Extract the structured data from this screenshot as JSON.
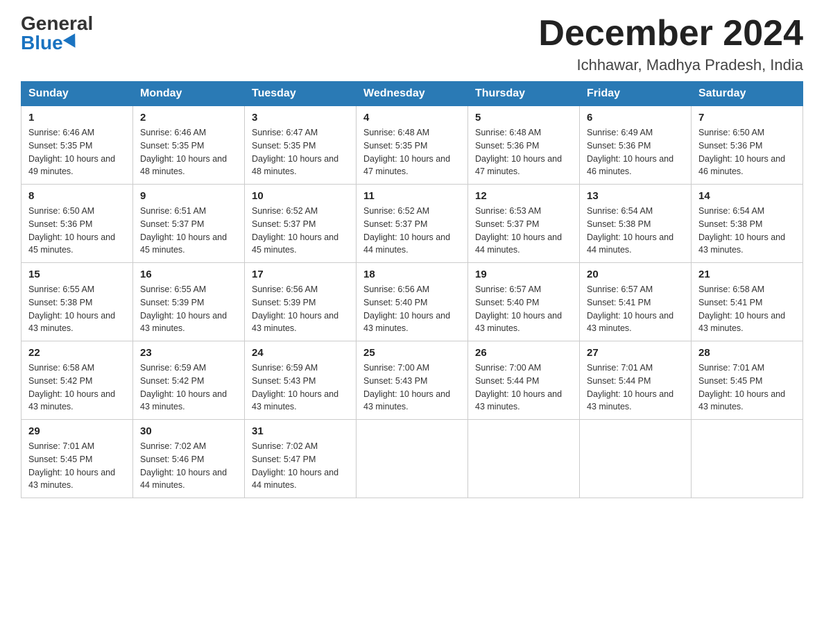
{
  "header": {
    "logo_general": "General",
    "logo_blue": "Blue",
    "month_title": "December 2024",
    "location": "Ichhawar, Madhya Pradesh, India"
  },
  "weekdays": [
    "Sunday",
    "Monday",
    "Tuesday",
    "Wednesday",
    "Thursday",
    "Friday",
    "Saturday"
  ],
  "weeks": [
    [
      {
        "day": "1",
        "sunrise": "6:46 AM",
        "sunset": "5:35 PM",
        "daylight": "10 hours and 49 minutes."
      },
      {
        "day": "2",
        "sunrise": "6:46 AM",
        "sunset": "5:35 PM",
        "daylight": "10 hours and 48 minutes."
      },
      {
        "day": "3",
        "sunrise": "6:47 AM",
        "sunset": "5:35 PM",
        "daylight": "10 hours and 48 minutes."
      },
      {
        "day": "4",
        "sunrise": "6:48 AM",
        "sunset": "5:35 PM",
        "daylight": "10 hours and 47 minutes."
      },
      {
        "day": "5",
        "sunrise": "6:48 AM",
        "sunset": "5:36 PM",
        "daylight": "10 hours and 47 minutes."
      },
      {
        "day": "6",
        "sunrise": "6:49 AM",
        "sunset": "5:36 PM",
        "daylight": "10 hours and 46 minutes."
      },
      {
        "day": "7",
        "sunrise": "6:50 AM",
        "sunset": "5:36 PM",
        "daylight": "10 hours and 46 minutes."
      }
    ],
    [
      {
        "day": "8",
        "sunrise": "6:50 AM",
        "sunset": "5:36 PM",
        "daylight": "10 hours and 45 minutes."
      },
      {
        "day": "9",
        "sunrise": "6:51 AM",
        "sunset": "5:37 PM",
        "daylight": "10 hours and 45 minutes."
      },
      {
        "day": "10",
        "sunrise": "6:52 AM",
        "sunset": "5:37 PM",
        "daylight": "10 hours and 45 minutes."
      },
      {
        "day": "11",
        "sunrise": "6:52 AM",
        "sunset": "5:37 PM",
        "daylight": "10 hours and 44 minutes."
      },
      {
        "day": "12",
        "sunrise": "6:53 AM",
        "sunset": "5:37 PM",
        "daylight": "10 hours and 44 minutes."
      },
      {
        "day": "13",
        "sunrise": "6:54 AM",
        "sunset": "5:38 PM",
        "daylight": "10 hours and 44 minutes."
      },
      {
        "day": "14",
        "sunrise": "6:54 AM",
        "sunset": "5:38 PM",
        "daylight": "10 hours and 43 minutes."
      }
    ],
    [
      {
        "day": "15",
        "sunrise": "6:55 AM",
        "sunset": "5:38 PM",
        "daylight": "10 hours and 43 minutes."
      },
      {
        "day": "16",
        "sunrise": "6:55 AM",
        "sunset": "5:39 PM",
        "daylight": "10 hours and 43 minutes."
      },
      {
        "day": "17",
        "sunrise": "6:56 AM",
        "sunset": "5:39 PM",
        "daylight": "10 hours and 43 minutes."
      },
      {
        "day": "18",
        "sunrise": "6:56 AM",
        "sunset": "5:40 PM",
        "daylight": "10 hours and 43 minutes."
      },
      {
        "day": "19",
        "sunrise": "6:57 AM",
        "sunset": "5:40 PM",
        "daylight": "10 hours and 43 minutes."
      },
      {
        "day": "20",
        "sunrise": "6:57 AM",
        "sunset": "5:41 PM",
        "daylight": "10 hours and 43 minutes."
      },
      {
        "day": "21",
        "sunrise": "6:58 AM",
        "sunset": "5:41 PM",
        "daylight": "10 hours and 43 minutes."
      }
    ],
    [
      {
        "day": "22",
        "sunrise": "6:58 AM",
        "sunset": "5:42 PM",
        "daylight": "10 hours and 43 minutes."
      },
      {
        "day": "23",
        "sunrise": "6:59 AM",
        "sunset": "5:42 PM",
        "daylight": "10 hours and 43 minutes."
      },
      {
        "day": "24",
        "sunrise": "6:59 AM",
        "sunset": "5:43 PM",
        "daylight": "10 hours and 43 minutes."
      },
      {
        "day": "25",
        "sunrise": "7:00 AM",
        "sunset": "5:43 PM",
        "daylight": "10 hours and 43 minutes."
      },
      {
        "day": "26",
        "sunrise": "7:00 AM",
        "sunset": "5:44 PM",
        "daylight": "10 hours and 43 minutes."
      },
      {
        "day": "27",
        "sunrise": "7:01 AM",
        "sunset": "5:44 PM",
        "daylight": "10 hours and 43 minutes."
      },
      {
        "day": "28",
        "sunrise": "7:01 AM",
        "sunset": "5:45 PM",
        "daylight": "10 hours and 43 minutes."
      }
    ],
    [
      {
        "day": "29",
        "sunrise": "7:01 AM",
        "sunset": "5:45 PM",
        "daylight": "10 hours and 43 minutes."
      },
      {
        "day": "30",
        "sunrise": "7:02 AM",
        "sunset": "5:46 PM",
        "daylight": "10 hours and 44 minutes."
      },
      {
        "day": "31",
        "sunrise": "7:02 AM",
        "sunset": "5:47 PM",
        "daylight": "10 hours and 44 minutes."
      },
      null,
      null,
      null,
      null
    ]
  ]
}
